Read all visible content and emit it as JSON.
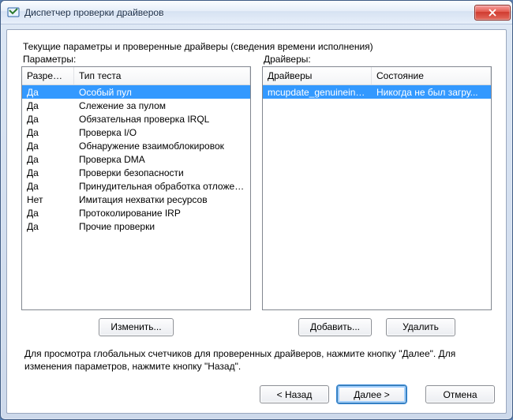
{
  "window": {
    "title": "Диспетчер проверки драйверов"
  },
  "caption": "Текущие параметры и проверенные драйверы (сведения времени исполнения)",
  "labels": {
    "params": "Параметры:",
    "drivers": "Драйверы:"
  },
  "params": {
    "columns": [
      "Разреше...",
      "Тип теста"
    ],
    "rows": [
      {
        "allowed": "Да",
        "test": "Особый пул",
        "selected": true
      },
      {
        "allowed": "Да",
        "test": "Слежение за пулом"
      },
      {
        "allowed": "Да",
        "test": "Обязательная проверка IRQL"
      },
      {
        "allowed": "Да",
        "test": "Проверка I/O"
      },
      {
        "allowed": "Да",
        "test": "Обнаружение взаимоблокировок"
      },
      {
        "allowed": "Да",
        "test": "Проверка DMA"
      },
      {
        "allowed": "Да",
        "test": "Проверки безопасности"
      },
      {
        "allowed": "Да",
        "test": "Принудительная обработка отложен..."
      },
      {
        "allowed": "Нет",
        "test": "Имитация нехватки ресурсов"
      },
      {
        "allowed": "Да",
        "test": "Протоколирование IRP"
      },
      {
        "allowed": "Да",
        "test": "Прочие проверки"
      }
    ]
  },
  "drivers": {
    "columns": [
      "Драйверы",
      "Состояние"
    ],
    "rows": [
      {
        "name": "mcupdate_genuineintel.dll",
        "status": "Никогда не был загру...",
        "selected": true
      }
    ]
  },
  "buttons": {
    "change": "Изменить...",
    "add": "Добавить...",
    "delete": "Удалить"
  },
  "hint": "Для просмотра глобальных счетчиков для проверенных драйверов, нажмите кнопку \"Далее\". Для изменения параметров, нажмите кнопку \"Назад\".",
  "wizard": {
    "back": "< Назад",
    "next": "Далее >",
    "cancel": "Отмена"
  }
}
